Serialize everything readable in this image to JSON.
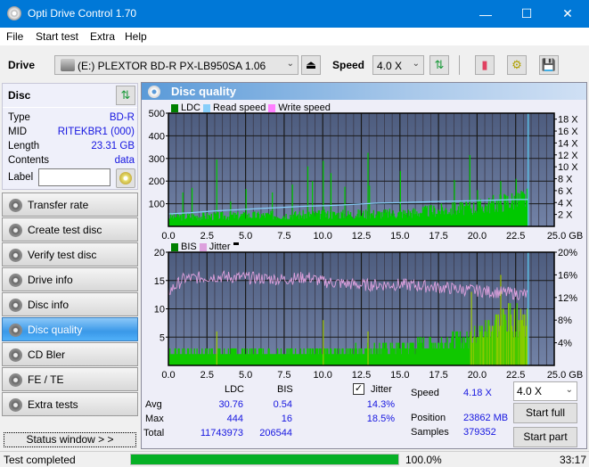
{
  "window": {
    "title": "Opti Drive Control 1.70",
    "minimize": "—",
    "maximize": "☐",
    "close": "✕"
  },
  "menu": [
    "File",
    "Start test",
    "Extra",
    "Help"
  ],
  "toolbar": {
    "drive_label": "Drive",
    "drive_value": "(E:)  PLEXTOR BD-R  PX-LB950SA 1.06",
    "speed_label": "Speed",
    "speed_value": "4.0 X"
  },
  "disc": {
    "header": "Disc",
    "type_label": "Type",
    "type": "BD-R",
    "mid_label": "MID",
    "mid": "RITEKBR1 (000)",
    "length_label": "Length",
    "length": "23.31 GB",
    "contents_label": "Contents",
    "contents": "data",
    "label_label": "Label",
    "label_value": ""
  },
  "nav": [
    {
      "label": "Transfer rate",
      "active": false
    },
    {
      "label": "Create test disc",
      "active": false
    },
    {
      "label": "Verify test disc",
      "active": false
    },
    {
      "label": "Drive info",
      "active": false
    },
    {
      "label": "Disc info",
      "active": false
    },
    {
      "label": "Disc quality",
      "active": true
    },
    {
      "label": "CD Bler",
      "active": false
    },
    {
      "label": "FE / TE",
      "active": false
    },
    {
      "label": "Extra tests",
      "active": false
    }
  ],
  "status_window_btn": "Status window > >",
  "panel": {
    "title": "Disc quality"
  },
  "chart_data": [
    {
      "type": "bar",
      "title": "LDC",
      "legend": [
        "LDC",
        "Read speed",
        "Write speed"
      ],
      "colors": {
        "LDC": "#00c800",
        "Read speed": "#87cefa",
        "Write speed": "#ff80ff"
      },
      "x_ticks": [
        "0.0",
        "2.5",
        "5.0",
        "7.5",
        "10.0",
        "12.5",
        "15.0",
        "17.5",
        "20.0",
        "22.5",
        "25.0 GB"
      ],
      "xlim": [
        0,
        25
      ],
      "y_ticks": [
        "100",
        "200",
        "300",
        "400",
        "500"
      ],
      "ylim": [
        0,
        500
      ],
      "y2_ticks": [
        "2 X",
        "4 X",
        "6 X",
        "8 X",
        "10 X",
        "12 X",
        "14 X",
        "16 X",
        "18 X"
      ],
      "y2lim": [
        0,
        19
      ],
      "ldc_baseline": [
        [
          0,
          45
        ],
        [
          5,
          50
        ],
        [
          10,
          55
        ],
        [
          15,
          60
        ],
        [
          20,
          90
        ],
        [
          22,
          120
        ],
        [
          23.31,
          130
        ]
      ],
      "ldc_spikes": [
        [
          0.9,
          150
        ],
        [
          1.5,
          170
        ],
        [
          3.1,
          295
        ],
        [
          4.0,
          110
        ],
        [
          5.0,
          165
        ],
        [
          6.7,
          150
        ],
        [
          8.0,
          185
        ],
        [
          9.0,
          265
        ],
        [
          9.3,
          200
        ],
        [
          10.0,
          290
        ],
        [
          10.5,
          235
        ],
        [
          11.4,
          175
        ],
        [
          12.9,
          325
        ],
        [
          13.0,
          180
        ],
        [
          15.0,
          245
        ],
        [
          18.5,
          205
        ],
        [
          19.5,
          315
        ],
        [
          20.0,
          160
        ],
        [
          21.5,
          200
        ],
        [
          22.5,
          210
        ]
      ],
      "read_speed": [
        [
          0,
          2.1
        ],
        [
          1.5,
          2.3
        ],
        [
          3,
          2.6
        ],
        [
          4.5,
          2.8
        ],
        [
          6,
          3.0
        ],
        [
          7.5,
          3.2
        ],
        [
          9,
          3.4
        ],
        [
          10.5,
          3.5
        ],
        [
          12,
          3.7
        ],
        [
          13.5,
          3.9
        ],
        [
          15,
          4.0
        ],
        [
          16.5,
          4.1
        ],
        [
          18,
          4.2
        ],
        [
          19.5,
          4.3
        ],
        [
          21,
          4.4
        ],
        [
          22.5,
          4.5
        ],
        [
          23.31,
          4.5
        ]
      ],
      "end_marker": 23.31
    },
    {
      "type": "bar",
      "title": "BIS",
      "legend": [
        "BIS",
        "Jitter"
      ],
      "colors": {
        "BIS": "#00c800",
        "Jitter": "#dda0dd"
      },
      "x_ticks": [
        "0.0",
        "2.5",
        "5.0",
        "7.5",
        "10.0",
        "12.5",
        "15.0",
        "17.5",
        "20.0",
        "22.5",
        "25.0 GB"
      ],
      "xlim": [
        0,
        25
      ],
      "y_ticks": [
        "5",
        "10",
        "15",
        "20"
      ],
      "ylim": [
        0,
        20
      ],
      "y2_ticks": [
        "4%",
        "8%",
        "12%",
        "16%",
        "20%"
      ],
      "y2lim": [
        0,
        20
      ],
      "bis_levels": [
        [
          0,
          3
        ],
        [
          10,
          3
        ],
        [
          15,
          4
        ],
        [
          19.5,
          6
        ],
        [
          21.5,
          10
        ],
        [
          23.31,
          10
        ]
      ],
      "jitter": [
        [
          0,
          13
        ],
        [
          1,
          15.3
        ],
        [
          3,
          15.7
        ],
        [
          5,
          15.5
        ],
        [
          7.5,
          15.2
        ],
        [
          9,
          15.6
        ],
        [
          10,
          14.8
        ],
        [
          12.5,
          14.2
        ],
        [
          15,
          14.3
        ],
        [
          17.5,
          13.8
        ],
        [
          20,
          13.2
        ],
        [
          22.5,
          12.7
        ],
        [
          23.31,
          12.5
        ]
      ],
      "end_marker": 23.31
    }
  ],
  "stats": {
    "col_ldc": "LDC",
    "col_bis": "BIS",
    "jitter_label": "Jitter",
    "jitter_checked": true,
    "avg_label": "Avg",
    "max_label": "Max",
    "total_label": "Total",
    "avg_ldc": "30.76",
    "avg_bis": "0.54",
    "avg_jitter": "14.3%",
    "max_ldc": "444",
    "max_bis": "16",
    "max_jitter": "18.5%",
    "total_ldc": "11743973",
    "total_bis": "206544",
    "speed_label": "Speed",
    "speed_value": "4.18 X",
    "position_label": "Position",
    "position_value": "23862 MB",
    "samples_label": "Samples",
    "samples_value": "379352",
    "speed_select": "4.0 X",
    "start_full": "Start full",
    "start_part": "Start part"
  },
  "statusbar": {
    "text": "Test completed",
    "progress": 100.0,
    "progress_text": "100.0%",
    "time": "33:17"
  }
}
